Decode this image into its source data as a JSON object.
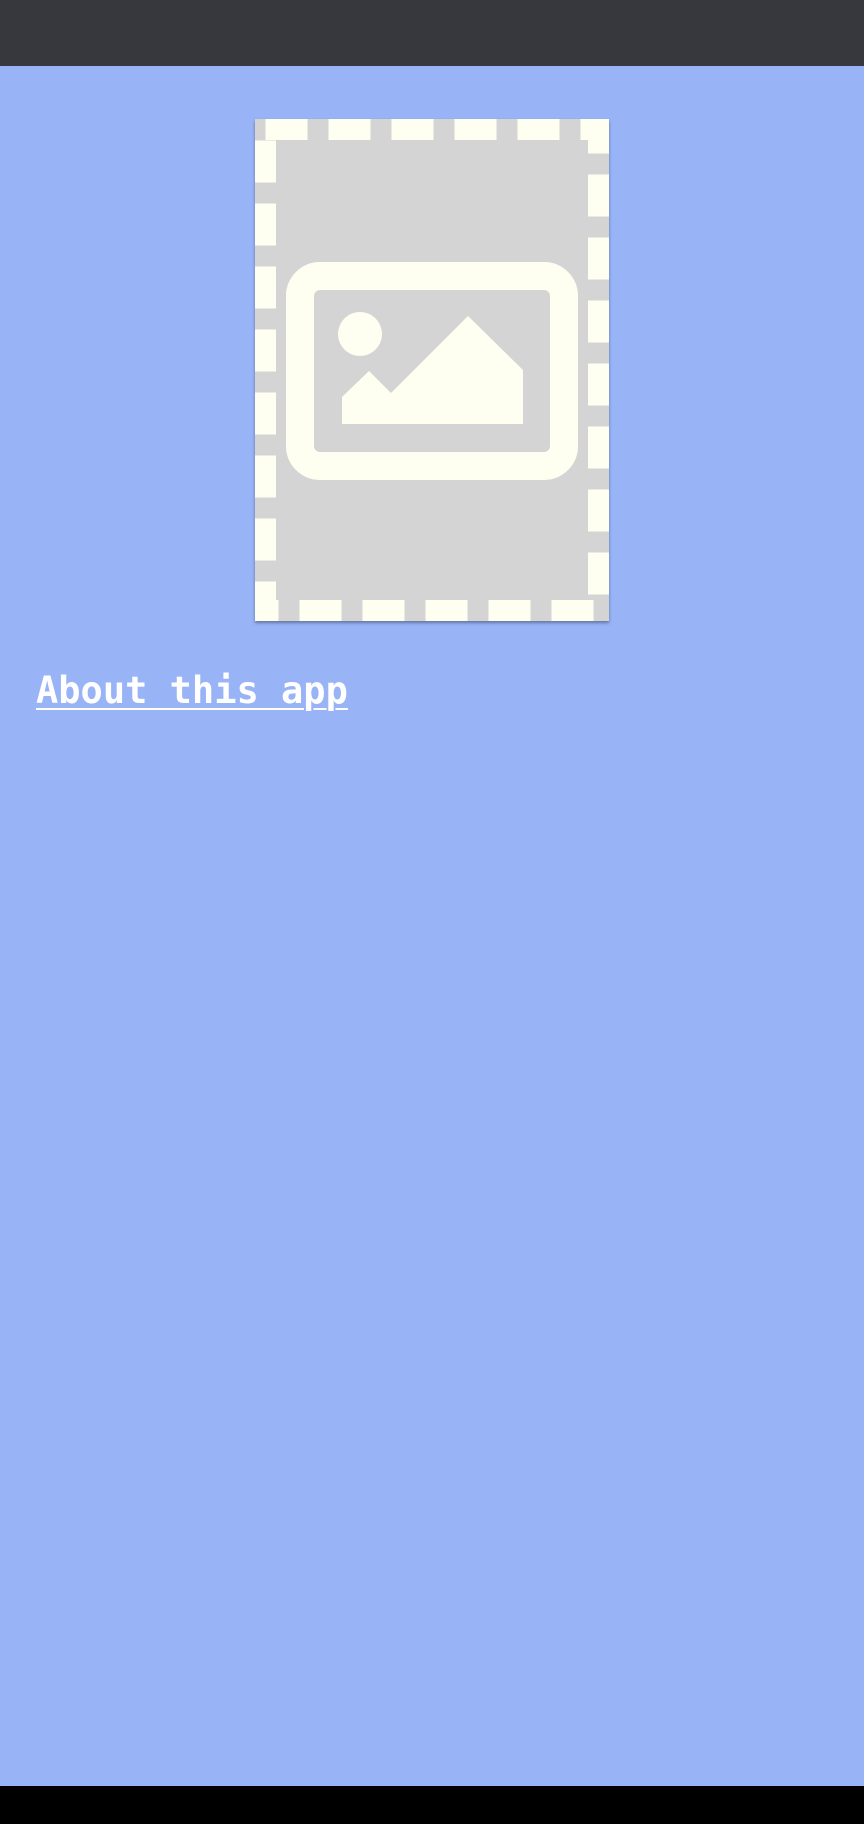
{
  "colors": {
    "status_bar": "#37383d",
    "background": "#98b4f7",
    "placeholder_fill": "#d4d4d4",
    "placeholder_border": "#fefff0",
    "link_text": "#ffffff",
    "nav_bar": "#000000"
  },
  "image": {
    "icon": "image-placeholder-icon"
  },
  "about": {
    "link_label": "About this app"
  }
}
